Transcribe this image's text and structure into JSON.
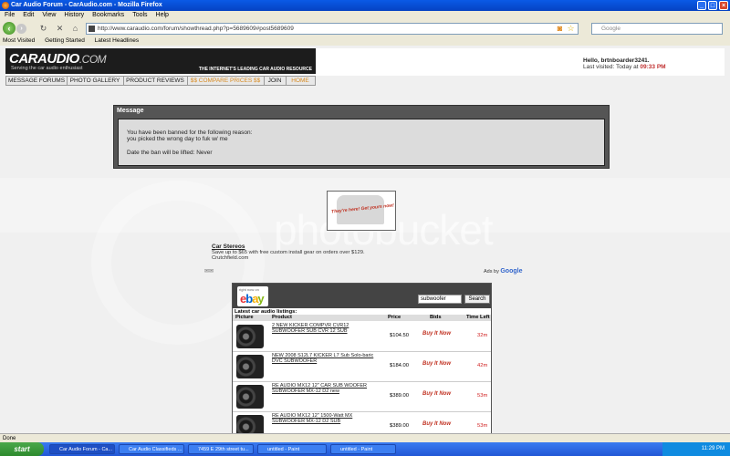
{
  "window": {
    "title": "Car Audio Forum - CarAudio.com - Mozilla Firefox"
  },
  "menu": [
    "File",
    "Edit",
    "View",
    "History",
    "Bookmarks",
    "Tools",
    "Help"
  ],
  "browser": {
    "url": "http://www.caraudio.com/forum/showthread.php?p=5689609#post5689609",
    "search_placeholder": "Google"
  },
  "bookmarks": [
    "Most Visited",
    "Getting Started",
    "Latest Headlines"
  ],
  "site": {
    "logo_main": "CARAUDIO",
    "logo_suffix": ".COM",
    "logo_tagline": "Serving the car audio enthusiast",
    "logo_slogan": "THE INTERNET'S LEADING CAR AUDIO RESOURCE",
    "greeting": "Hello, brtnboarder3241.",
    "last_visited_label": "Last visited: Today at",
    "last_visited_time": "09:33 PM",
    "tabs": [
      "MESSAGE FORUMS",
      "PHOTO GALLERY",
      "PRODUCT REVIEWS",
      "$$ COMPARE PRICES $$",
      "JOIN",
      "HOME"
    ]
  },
  "message": {
    "header": "Message",
    "line1": "You have been banned for the following reason:",
    "line2": "you picked the wrong day to fuk w/ me",
    "line3": "Date the ban will be lifted: Never"
  },
  "watermark": "photobucket",
  "shirt_ad": {
    "slogan": "They're here! Get yours now!"
  },
  "text_ad": {
    "link": "Car Stereos",
    "text": "Save up to $65 with free custom install gear on orders over $129.",
    "url": "Crutchfield.com",
    "ads_by": "Ads by",
    "ads_brand": "Google"
  },
  "ebay": {
    "right_now_on": "right now on",
    "logo": "ebay",
    "search_value": "subwoofer",
    "search_button": "Search",
    "listings_title": "Latest car audio listings:",
    "columns": [
      "Picture",
      "Product",
      "Price",
      "Bids",
      "Time Left"
    ],
    "listings": [
      {
        "product": "2 NEW KICKER COMPVR CVR12 SUBWOOFER SUB CVR 12 SUB",
        "price": "$104.50",
        "bids": "Buy It Now",
        "time_left": "32m"
      },
      {
        "product": "NEW 2008 S12L7 KICKER L7 Sub Solo-baric DVC SUBWOOFER",
        "price": "$184.00",
        "bids": "Buy It Now",
        "time_left": "42m"
      },
      {
        "product": "RE AUDIO MX12 12\" CAR SUB WOOFER SUBWOOFER MX-12 D2 new",
        "price": "$389.00",
        "bids": "Buy It Now",
        "time_left": "53m"
      },
      {
        "product": "RE AUDIO MX12 12\" 1500-Watt MX SUBWOOFER MX-12 D2 SUB",
        "price": "$389.00",
        "bids": "Buy It Now",
        "time_left": "53m"
      }
    ]
  },
  "status": "Done",
  "taskbar": {
    "start": "start",
    "tasks": [
      "Car Audio Forum - Ca...",
      "Car Audio Classifieds ...",
      "7459 E 29th street tu...",
      "untitled - Paint",
      "untitled - Paint"
    ],
    "clock": "11:29 PM"
  },
  "colors": {
    "titlebar": "#0542c2",
    "accent_orange": "#d88a20",
    "ban_red": "#c03030"
  }
}
